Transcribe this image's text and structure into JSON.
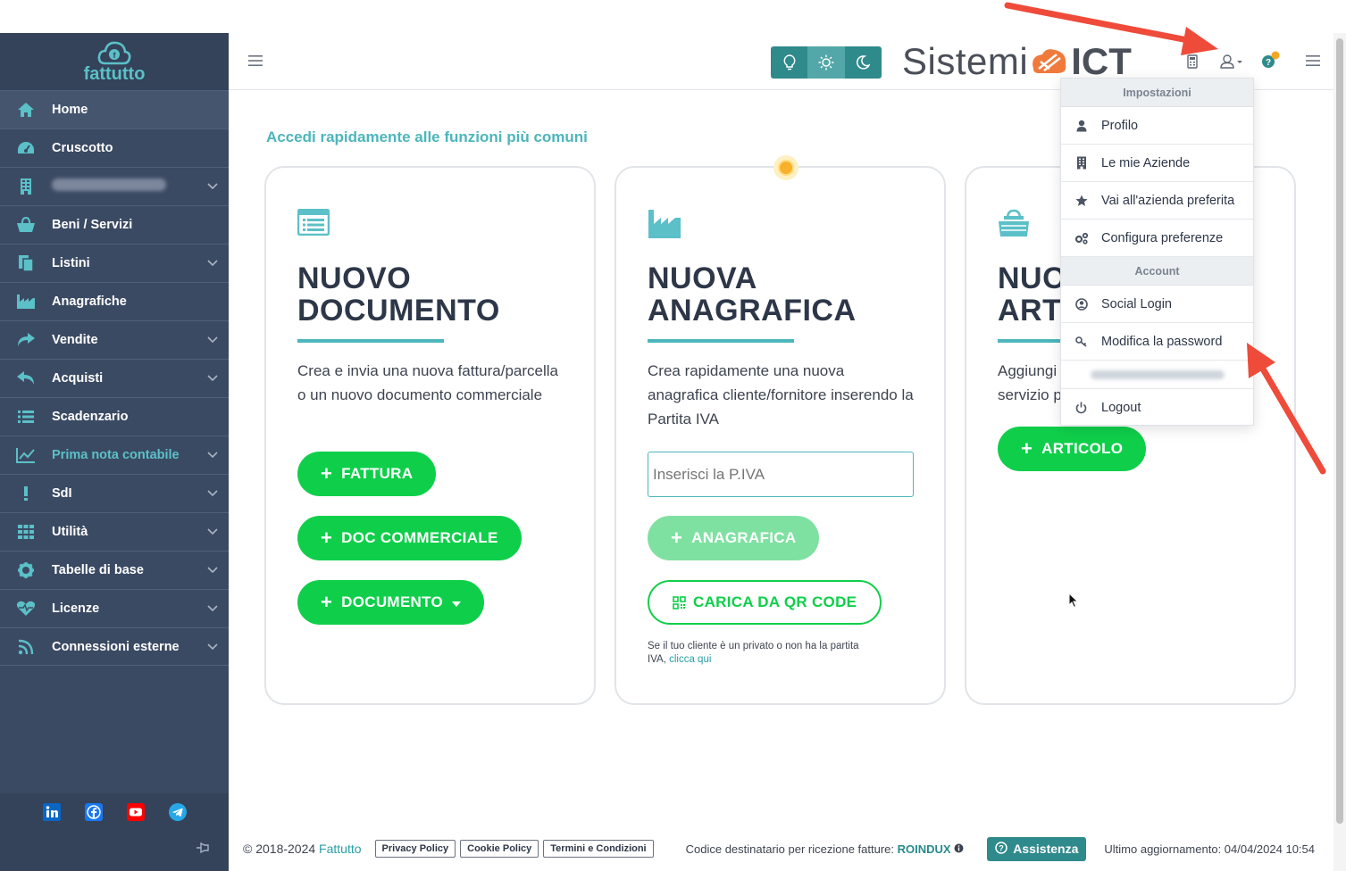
{
  "brand": {
    "name": "fattutto"
  },
  "sidebar": {
    "items": [
      {
        "label": "Home",
        "icon": "home-icon",
        "dropdown": false
      },
      {
        "label": "Cruscotto",
        "icon": "dashboard-icon",
        "dropdown": false
      },
      {
        "label": "",
        "icon": "building-icon",
        "dropdown": true
      },
      {
        "label": "Beni / Servizi",
        "icon": "basket-icon",
        "dropdown": false
      },
      {
        "label": "Listini",
        "icon": "files-icon",
        "dropdown": true
      },
      {
        "label": "Anagrafiche",
        "icon": "factory-icon",
        "dropdown": false
      },
      {
        "label": "Vendite",
        "icon": "share-icon",
        "dropdown": true
      },
      {
        "label": "Acquisti",
        "icon": "reply-icon",
        "dropdown": true
      },
      {
        "label": "Scadenzario",
        "icon": "list-icon",
        "dropdown": false
      },
      {
        "label": "Prima nota contabile",
        "icon": "chart-line-icon",
        "dropdown": true
      },
      {
        "label": "SdI",
        "icon": "exclamation-icon",
        "dropdown": true
      },
      {
        "label": "Utilità",
        "icon": "grid-icon",
        "dropdown": true
      },
      {
        "label": "Tabelle di base",
        "icon": "gear-icon",
        "dropdown": true
      },
      {
        "label": "Licenze",
        "icon": "heartbeat-icon",
        "dropdown": true
      },
      {
        "label": "Connessioni esterne",
        "icon": "rss-icon",
        "dropdown": true
      }
    ]
  },
  "topbar": {
    "logo_text": "Sistemi",
    "logo_bold": "ICT"
  },
  "main": {
    "section_title": "Accedi rapidamente alle funzioni più comuni",
    "card1": {
      "title_line1": "NUOVO",
      "title_line2": "DOCUMENTO",
      "description": "Crea e invia una nuova fattura/parcella o un nuovo documento commerciale",
      "btn_fattura": "FATTURA",
      "btn_doc_commerciale": "DOC COMMERCIALE",
      "btn_documento": "DOCUMENTO"
    },
    "card2": {
      "title_line1": "NUOVA",
      "title_line2": "ANAGRAFICA",
      "description": "Crea rapidamente una nuova anagrafica cliente/fornitore inserendo la Partita IVA",
      "piva_placeholder": "Inserisci la P.IVA",
      "btn_anagrafica": "ANAGRAFICA",
      "btn_qr": "CARICA DA QR CODE",
      "note": "Se il tuo cliente è un privato o non ha la partita IVA,",
      "note_link": "clicca qui"
    },
    "card3": {
      "title_line1": "NUO",
      "title_line2": "ART",
      "description": "Aggiungi servizio p",
      "btn_articolo": "ARTICOLO"
    }
  },
  "user_menu": {
    "header_impostazioni": "Impostazioni",
    "profilo": "Profilo",
    "le_mie_aziende": "Le mie Aziende",
    "vai_azienda_preferita": "Vai all'azienda preferita",
    "configura_preferenze": "Configura preferenze",
    "header_account": "Account",
    "social_login": "Social Login",
    "modifica_password": "Modifica la password",
    "logout": "Logout"
  },
  "footer": {
    "copyright": "© 2018-2024",
    "copyright_link": "Fattutto",
    "privacy": "Privacy Policy",
    "cookie": "Cookie Policy",
    "termini": "Termini e Condizioni",
    "codice_label": "Codice destinatario per ricezione fatture:",
    "codice_value": "ROINDUX",
    "assistenza": "Assistenza",
    "ultimo_aggiornamento": "Ultimo aggiornamento: 04/04/2024 10:54"
  },
  "colors": {
    "sidebar_bg": "#3b4a63",
    "accent_teal": "#4cb6bb",
    "button_green": "#0fcf4a",
    "annotation_red": "#ef4b3a"
  }
}
